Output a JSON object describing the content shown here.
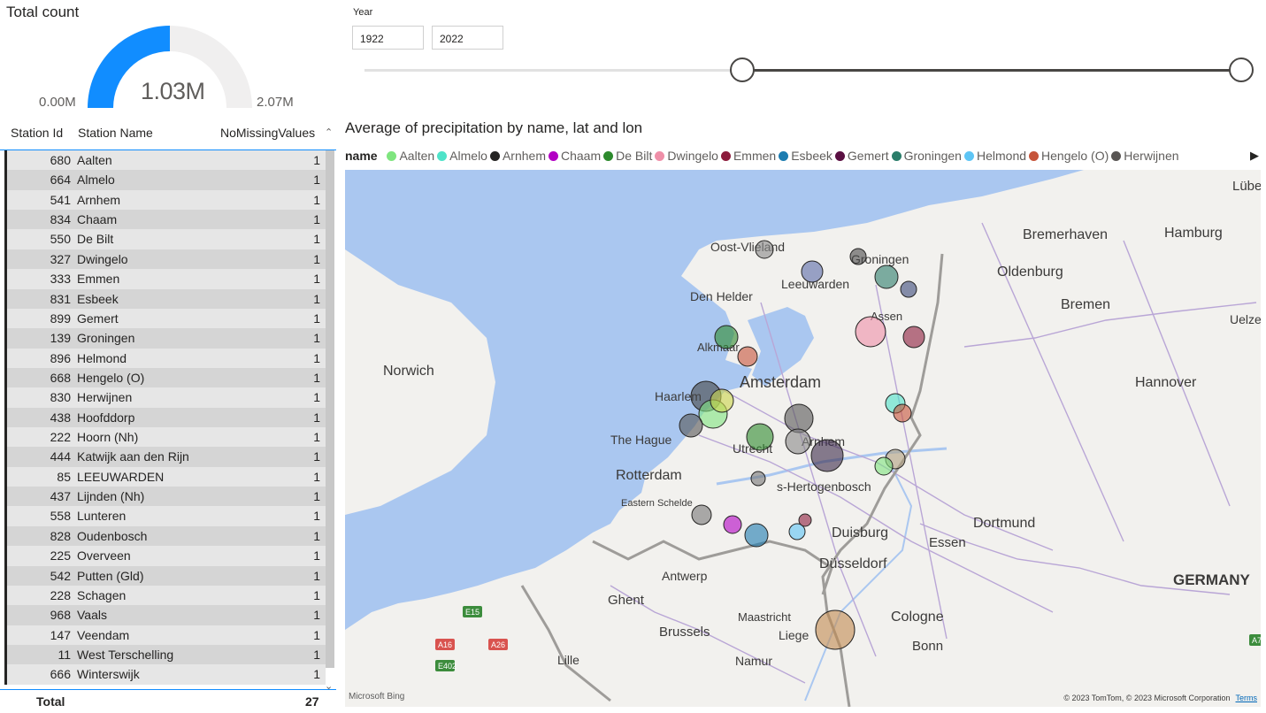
{
  "gauge": {
    "title": "Total count",
    "value": "1.03M",
    "min": "0.00M",
    "max": "2.07M",
    "fill_fraction": 0.5,
    "fill_color": "#118dff",
    "track_color": "#f0efef"
  },
  "table": {
    "columns": [
      "Station Id",
      "Station Name",
      "NoMissingValues"
    ],
    "rows": [
      {
        "id": "680",
        "name": "Aalten",
        "missing": "1"
      },
      {
        "id": "664",
        "name": "Almelo",
        "missing": "1"
      },
      {
        "id": "541",
        "name": "Arnhem",
        "missing": "1"
      },
      {
        "id": "834",
        "name": "Chaam",
        "missing": "1"
      },
      {
        "id": "550",
        "name": "De Bilt",
        "missing": "1"
      },
      {
        "id": "327",
        "name": "Dwingelo",
        "missing": "1"
      },
      {
        "id": "333",
        "name": "Emmen",
        "missing": "1"
      },
      {
        "id": "831",
        "name": "Esbeek",
        "missing": "1"
      },
      {
        "id": "899",
        "name": "Gemert",
        "missing": "1"
      },
      {
        "id": "139",
        "name": "Groningen",
        "missing": "1"
      },
      {
        "id": "896",
        "name": "Helmond",
        "missing": "1"
      },
      {
        "id": "668",
        "name": "Hengelo (O)",
        "missing": "1"
      },
      {
        "id": "830",
        "name": "Herwijnen",
        "missing": "1"
      },
      {
        "id": "438",
        "name": "Hoofddorp",
        "missing": "1"
      },
      {
        "id": "222",
        "name": "Hoorn (Nh)",
        "missing": "1"
      },
      {
        "id": "444",
        "name": "Katwijk aan den Rijn",
        "missing": "1"
      },
      {
        "id": "85",
        "name": "LEEUWARDEN",
        "missing": "1"
      },
      {
        "id": "437",
        "name": "Lijnden (Nh)",
        "missing": "1"
      },
      {
        "id": "558",
        "name": "Lunteren",
        "missing": "1"
      },
      {
        "id": "828",
        "name": "Oudenbosch",
        "missing": "1"
      },
      {
        "id": "225",
        "name": "Overveen",
        "missing": "1"
      },
      {
        "id": "542",
        "name": "Putten (Gld)",
        "missing": "1"
      },
      {
        "id": "228",
        "name": "Schagen",
        "missing": "1"
      },
      {
        "id": "968",
        "name": "Vaals",
        "missing": "1"
      },
      {
        "id": "147",
        "name": "Veendam",
        "missing": "1"
      },
      {
        "id": "11",
        "name": "West Terschelling",
        "missing": "1"
      },
      {
        "id": "666",
        "name": "Winterswijk",
        "missing": "1"
      }
    ],
    "total_label": "Total",
    "total_value": "27"
  },
  "slicer": {
    "title": "Year",
    "start": "1922",
    "end": "2022"
  },
  "map": {
    "title": "Average of precipitation by name, lat and lon",
    "legend_label": "name",
    "legend": [
      {
        "name": "Aalten",
        "color": "#7fe57f"
      },
      {
        "name": "Almelo",
        "color": "#4fe3c9"
      },
      {
        "name": "Arnhem",
        "color": "#252423"
      },
      {
        "name": "Chaam",
        "color": "#b300c4"
      },
      {
        "name": "De Bilt",
        "color": "#2d8a2d"
      },
      {
        "name": "Dwingelo",
        "color": "#ef8fa8"
      },
      {
        "name": "Emmen",
        "color": "#8c1c3c"
      },
      {
        "name": "Esbeek",
        "color": "#1c7cb0"
      },
      {
        "name": "Gemert",
        "color": "#5a0f42"
      },
      {
        "name": "Groningen",
        "color": "#2b7d6a"
      },
      {
        "name": "Helmond",
        "color": "#5ec5f5"
      },
      {
        "name": "Hengelo (O)",
        "color": "#c6543a"
      },
      {
        "name": "Herwijnen",
        "color": "#595654"
      }
    ],
    "cities": {
      "oost_vlieland": "Oost-Vlieland",
      "groningen": "Groningen",
      "leeuwarden": "Leeuwarden",
      "den_helder": "Den Helder",
      "assen": "Assen",
      "alkmaar": "Alkmaar",
      "norwich": "Norwich",
      "amsterdam": "Amsterdam",
      "haarlem": "Haarlem",
      "the_hague": "The Hague",
      "utrecht": "Utrecht",
      "arnhem": "Arnhem",
      "rotterdam": "Rotterdam",
      "s_hertogenbosch": "s-Hertogenbosch",
      "eastern_schelde": "Eastern Schelde",
      "duisburg": "Duisburg",
      "essen": "Essen",
      "dortmund": "Dortmund",
      "dusseldorf": "Düsseldorf",
      "antwerp": "Antwerp",
      "ghent": "Ghent",
      "brussels": "Brussels",
      "maastricht": "Maastricht",
      "liege": "Liege",
      "cologne": "Cologne",
      "bonn": "Bonn",
      "namur": "Namur",
      "lille": "Lille",
      "bremerhaven": "Bremerhaven",
      "hamburg": "Hamburg",
      "oldenburg": "Oldenburg",
      "bremen": "Bremen",
      "hannover": "Hannover",
      "uelzen": "Uelzen",
      "lubeck": "Lübe",
      "germany": "GERMANY"
    },
    "roads": [
      "E15",
      "A16",
      "A26",
      "E402",
      "A7"
    ],
    "bing_logo": "Microsoft Bing",
    "copyright": "© 2023 TomTom, © 2023 Microsoft Corporation",
    "terms": "Terms",
    "water_color": "#aac7f0",
    "land_color": "#f2f1ee"
  }
}
